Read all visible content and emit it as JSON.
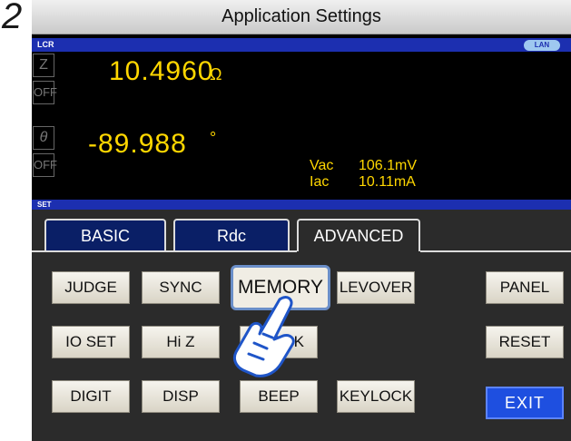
{
  "step_number": "2",
  "window_title": "Application Settings",
  "lcr_label": "LCR",
  "lan_label": "LAN",
  "set_label": "SET",
  "params": {
    "p1": "Z",
    "p1_range": "OFF",
    "p2": "θ",
    "p2_range": "OFF"
  },
  "readings": {
    "z_value": "10.4960",
    "z_unit": "Ω",
    "theta_value": "-89.988",
    "theta_unit": "°"
  },
  "monitor": {
    "vac_label": "Vac",
    "vac_value": "106.1mV",
    "iac_label": "Iac",
    "iac_value": "10.11mA"
  },
  "tabs": [
    {
      "label": "BASIC"
    },
    {
      "label": "Rdc"
    },
    {
      "label": "ADVANCED"
    }
  ],
  "buttons": {
    "judge": "JUDGE",
    "sync": "SYNC",
    "memory": "MEMORY",
    "levover": "LEVOVER",
    "panel": "PANEL",
    "io_set": "IO SET",
    "hi_z": "Hi Z",
    "chk": "CHK",
    "reset": "RESET",
    "digit": "DIGIT",
    "disp": "DISP",
    "beep": "BEEP",
    "keylock": "KEYLOCK",
    "exit": "EXIT"
  }
}
